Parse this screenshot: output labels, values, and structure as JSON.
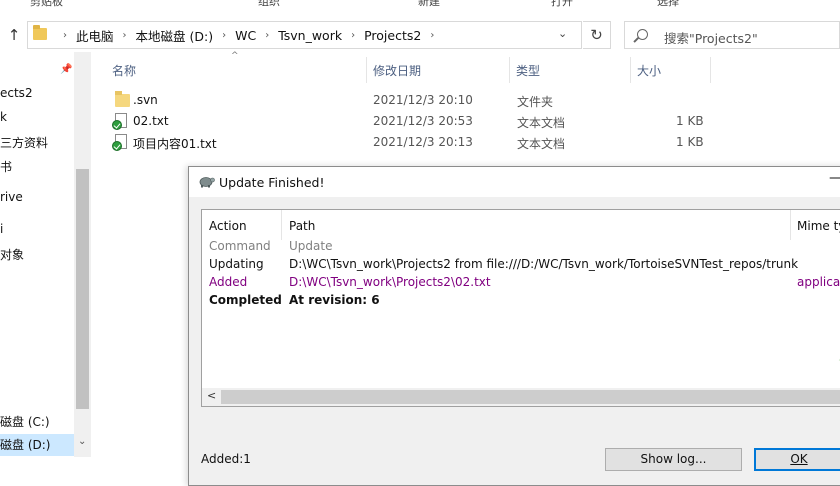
{
  "ribbon": {
    "group1": "剪贴板",
    "group2": "组织",
    "group3": "新建",
    "group4": "打开",
    "group5": "选择"
  },
  "address": {
    "crumbs": [
      "此电脑",
      "本地磁盘 (D:)",
      "WC",
      "Tsvn_work",
      "Projects2"
    ],
    "search_placeholder": "搜索\"Projects2\""
  },
  "nav": {
    "items": [
      {
        "label": "ects2"
      },
      {
        "label": "k"
      },
      {
        "label": "三方资料"
      },
      {
        "label": "书"
      },
      {
        "label": "rive"
      },
      {
        "label": "i"
      },
      {
        "label": "对象"
      },
      {
        "label": "磁盘 (C:)"
      },
      {
        "label": "磁盘 (D:)"
      }
    ]
  },
  "files": {
    "columns": {
      "name": "名称",
      "date": "修改日期",
      "type": "类型",
      "size": "大小"
    },
    "rows": [
      {
        "name": ".svn",
        "date": "2021/12/3 20:10",
        "type": "文件夹",
        "size": "",
        "icon": "folder-icon"
      },
      {
        "name": "02.txt",
        "date": "2021/12/3 20:53",
        "type": "文本文档",
        "size": "1 KB",
        "icon": "svn-normal-text-file-icon"
      },
      {
        "name": "项目内容01.txt",
        "date": "2021/12/3 20:13",
        "type": "文本文档",
        "size": "1 KB",
        "icon": "svn-normal-text-file-icon"
      }
    ]
  },
  "dialog": {
    "title": "Update Finished!",
    "minimize": "—",
    "columns": {
      "action": "Action",
      "path": "Path",
      "mime": "Mime ty"
    },
    "rows": [
      {
        "action": "Command",
        "path": "Update",
        "mime": "",
        "style": "gray"
      },
      {
        "action": "Updating",
        "path": "D:\\WC\\Tsvn_work\\Projects2 from file:///D:/WC/Tsvn_work/TortoiseSVNTest_repos/trunk",
        "mime": "",
        "style": "black"
      },
      {
        "action": "Added",
        "path": "D:\\WC\\Tsvn_work\\Projects2\\02.txt",
        "mime": "applicati",
        "style": "purple"
      },
      {
        "action": "Completed",
        "path": "At revision: 6",
        "mime": "",
        "style": "bold"
      }
    ],
    "status": "Added:1",
    "show_log_label": "Show log...",
    "ok_label": "OK"
  },
  "colors": {
    "accent": "#0078d7",
    "added": "#800080",
    "column_header": "#4d6082",
    "selected_nav": "#cce8ff"
  }
}
